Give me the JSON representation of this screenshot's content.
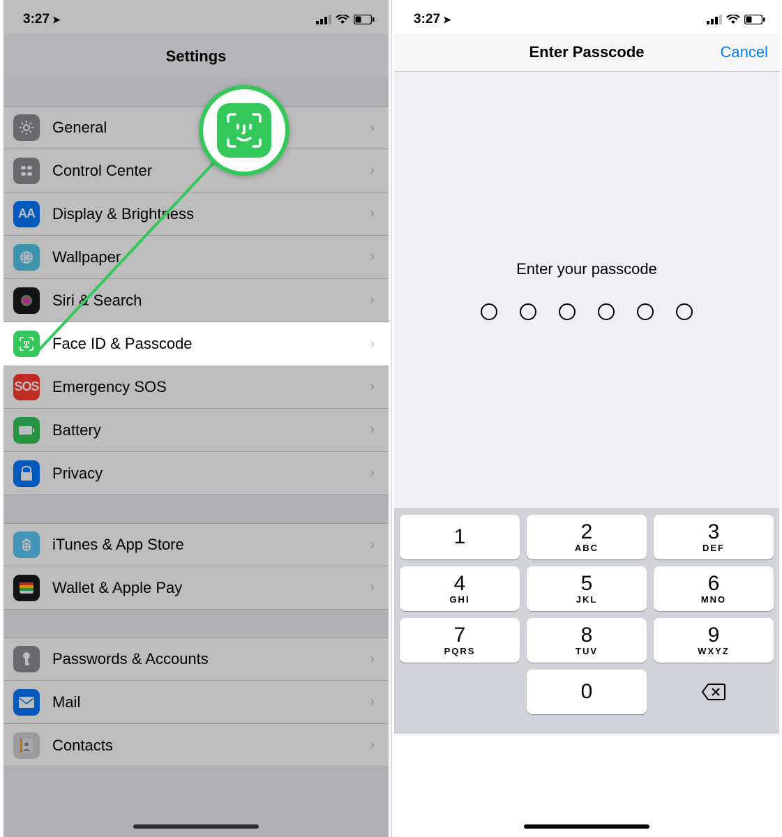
{
  "statusbar": {
    "time": "3:27"
  },
  "settings": {
    "title": "Settings",
    "group1": [
      {
        "label": "General",
        "icon": "general"
      },
      {
        "label": "Control Center",
        "icon": "control"
      },
      {
        "label": "Display & Brightness",
        "icon": "display",
        "iconText": "AA"
      },
      {
        "label": "Wallpaper",
        "icon": "wallpaper"
      },
      {
        "label": "Siri & Search",
        "icon": "siri"
      },
      {
        "label": "Face ID & Passcode",
        "icon": "faceid"
      },
      {
        "label": "Emergency SOS",
        "icon": "sos",
        "iconText": "SOS"
      },
      {
        "label": "Battery",
        "icon": "battery"
      },
      {
        "label": "Privacy",
        "icon": "privacy"
      }
    ],
    "group2": [
      {
        "label": "iTunes & App Store",
        "icon": "itunes"
      },
      {
        "label": "Wallet & Apple Pay",
        "icon": "wallet"
      }
    ],
    "group3": [
      {
        "label": "Passwords & Accounts",
        "icon": "passwords"
      },
      {
        "label": "Mail",
        "icon": "mail"
      },
      {
        "label": "Contacts",
        "icon": "contacts"
      }
    ],
    "highlighted_index": 5
  },
  "passcode": {
    "nav_title": "Enter Passcode",
    "cancel": "Cancel",
    "prompt": "Enter your passcode",
    "digits": 6,
    "keys": [
      {
        "d": "1",
        "l": ""
      },
      {
        "d": "2",
        "l": "ABC"
      },
      {
        "d": "3",
        "l": "DEF"
      },
      {
        "d": "4",
        "l": "GHI"
      },
      {
        "d": "5",
        "l": "JKL"
      },
      {
        "d": "6",
        "l": "MNO"
      },
      {
        "d": "7",
        "l": "PQRS"
      },
      {
        "d": "8",
        "l": "TUV"
      },
      {
        "d": "9",
        "l": "WXYZ"
      },
      {
        "blank": true
      },
      {
        "d": "0",
        "l": ""
      },
      {
        "del": true
      }
    ]
  }
}
